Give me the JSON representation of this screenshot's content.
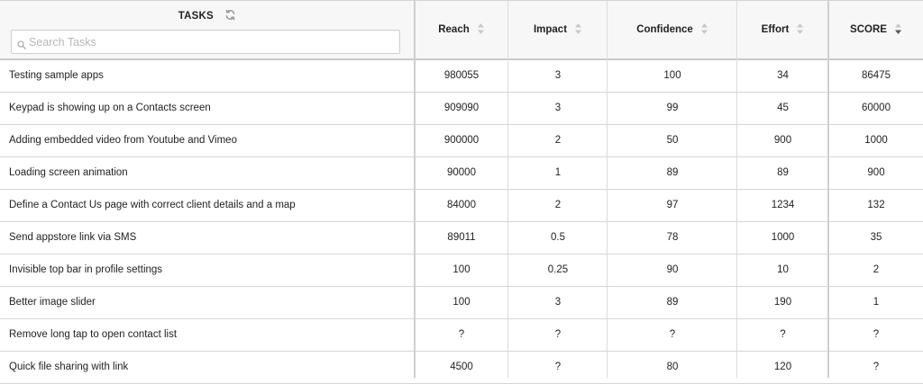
{
  "header": {
    "tasks_title": "TASKS",
    "search_placeholder": "Search Tasks",
    "search_value": "",
    "columns": [
      {
        "label": "Reach",
        "sort": "none"
      },
      {
        "label": "Impact",
        "sort": "none"
      },
      {
        "label": "Confidence",
        "sort": "none"
      },
      {
        "label": "Effort",
        "sort": "none"
      },
      {
        "label": "SCORE",
        "sort": "descending"
      }
    ]
  },
  "rows": [
    {
      "task": "Testing sample apps",
      "reach": "980055",
      "impact": "3",
      "confidence": "100",
      "effort": "34",
      "score": "86475"
    },
    {
      "task": "Keypad is showing up on a Contacts screen",
      "reach": "909090",
      "impact": "3",
      "confidence": "99",
      "effort": "45",
      "score": "60000"
    },
    {
      "task": "Adding embedded video from Youtube and Vimeo",
      "reach": "900000",
      "impact": "2",
      "confidence": "50",
      "effort": "900",
      "score": "1000"
    },
    {
      "task": "Loading screen animation",
      "reach": "90000",
      "impact": "1",
      "confidence": "89",
      "effort": "89",
      "score": "900"
    },
    {
      "task": "Define a Contact Us page with correct client details and a map",
      "reach": "84000",
      "impact": "2",
      "confidence": "97",
      "effort": "1234",
      "score": "132"
    },
    {
      "task": "Send appstore link via SMS",
      "reach": "89011",
      "impact": "0.5",
      "confidence": "78",
      "effort": "1000",
      "score": "35"
    },
    {
      "task": "Invisible top bar in profile settings",
      "reach": "100",
      "impact": "0.25",
      "confidence": "90",
      "effort": "10",
      "score": "2"
    },
    {
      "task": "Better image slider",
      "reach": "100",
      "impact": "3",
      "confidence": "89",
      "effort": "190",
      "score": "1"
    },
    {
      "task": "Remove long tap to open contact list",
      "reach": "?",
      "impact": "?",
      "confidence": "?",
      "effort": "?",
      "score": "?"
    },
    {
      "task": "Quick file sharing with link",
      "reach": "4500",
      "impact": "?",
      "confidence": "80",
      "effort": "120",
      "score": "?"
    }
  ],
  "colors": {
    "header_bg": "#f7f7f7",
    "border": "#d6d6d6",
    "text": "#222222",
    "icon": "#a8a8a8"
  }
}
